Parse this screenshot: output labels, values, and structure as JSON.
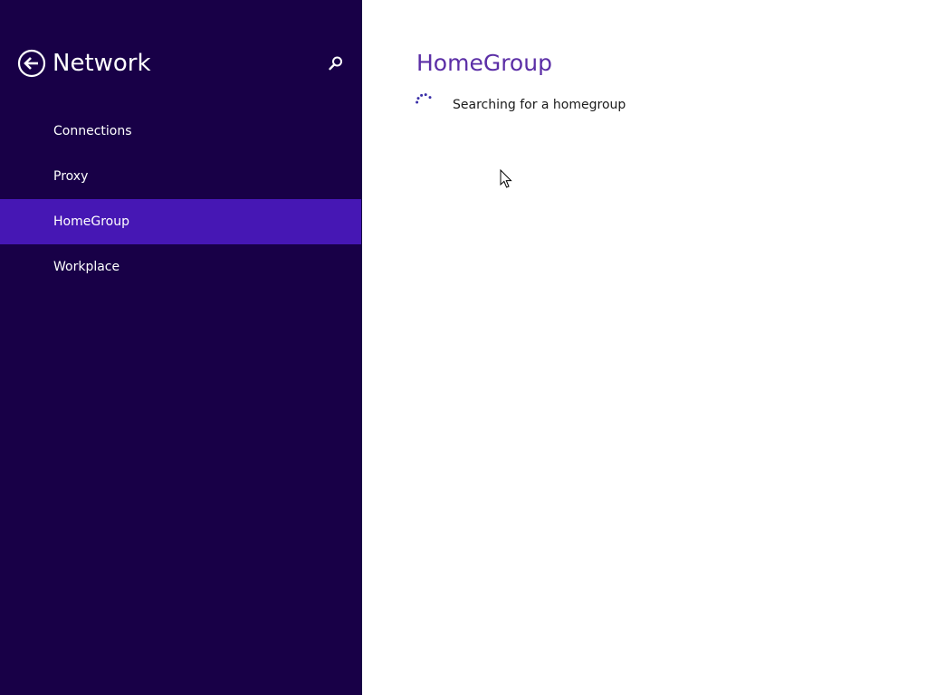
{
  "sidebar": {
    "title": "Network",
    "back_icon": "back-arrow-circle-icon",
    "search_icon": "search-icon",
    "items": [
      {
        "label": "Connections",
        "selected": false
      },
      {
        "label": "Proxy",
        "selected": false
      },
      {
        "label": "HomeGroup",
        "selected": true
      },
      {
        "label": "Workplace",
        "selected": false
      }
    ]
  },
  "main": {
    "title": "HomeGroup",
    "status_text": "Searching for a homegroup",
    "progress_icon": "progress-ring-icon"
  },
  "colors": {
    "sidebar_background": "#180047",
    "selected_item": "#4617b4",
    "accent_title": "#5b2ea6",
    "main_background": "#ffffff"
  }
}
